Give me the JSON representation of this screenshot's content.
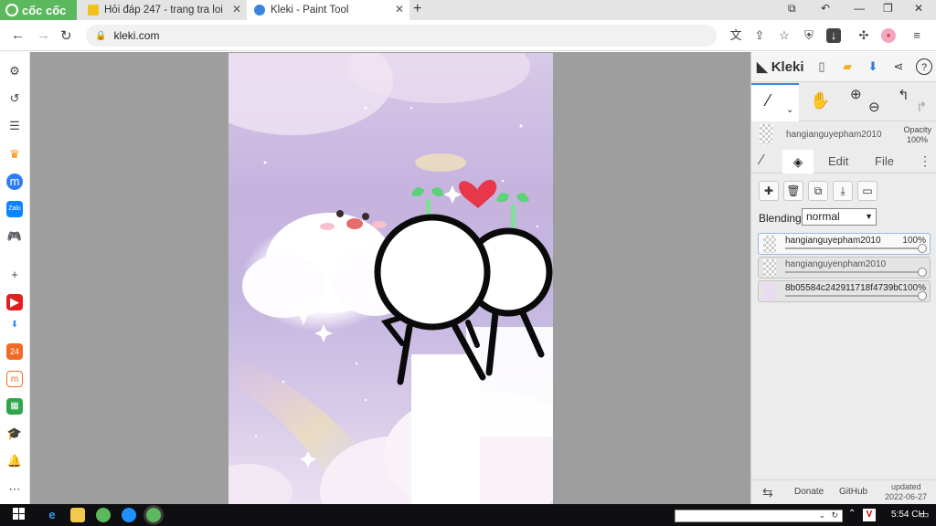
{
  "browser": {
    "brand": "cốc cốc",
    "tabs": [
      {
        "label": "Hỏi đáp 247 - trang tra loi",
        "active": false
      },
      {
        "label": "Kleki - Paint Tool",
        "active": true
      }
    ],
    "url": "kleki.com"
  },
  "colors": {
    "brand_green": "#5cb85c",
    "accent_blue": "#3a84df",
    "canvas_bg": "#9e9e9e"
  },
  "kleki": {
    "logo": "Kleki",
    "opacity_label": "Opacity",
    "opacity_value": "100%",
    "current_layer": "hangianguyepham2010",
    "tabs": {
      "edit": "Edit",
      "file": "File"
    },
    "blending_label": "Blending",
    "blending_value": "normal",
    "layers": [
      {
        "name": "hangianguyepham2010",
        "opacity": "100%",
        "selected": true
      },
      {
        "name": "hangianguyenpham2010",
        "opacity": "",
        "selected": false
      },
      {
        "name": "8b05584c242911718f4739b0",
        "opacity": "100%",
        "selected": false
      }
    ],
    "footer": {
      "donate": "Donate",
      "github": "GitHub",
      "updated_label": "updated",
      "updated_date": "2022-06-27"
    }
  },
  "taskbar": {
    "clock": "5:54 CH"
  }
}
